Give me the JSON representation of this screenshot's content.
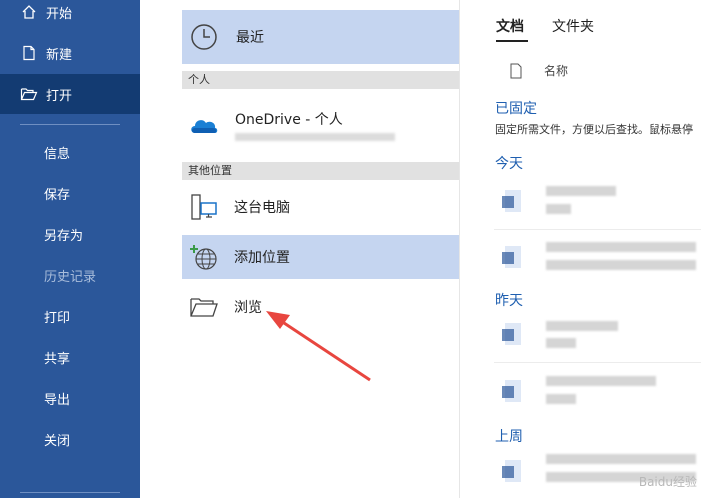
{
  "nav": {
    "home": "开始",
    "new": "新建",
    "open": "打开",
    "info": "信息",
    "save": "保存",
    "save_as": "另存为",
    "history": "历史记录",
    "print": "打印",
    "share": "共享",
    "export": "导出",
    "close": "关闭"
  },
  "locations": {
    "recent": "最近",
    "personal_header": "个人",
    "onedrive": "OneDrive - 个人",
    "other_header": "其他位置",
    "this_pc": "这台电脑",
    "add_place": "添加位置",
    "browse": "浏览"
  },
  "files": {
    "tab_documents": "文档",
    "tab_folders": "文件夹",
    "column_name": "名称",
    "pinned_title": "已固定",
    "pinned_desc": "固定所需文件，方便以后查找。鼠标悬停",
    "today": "今天",
    "yesterday": "昨天",
    "last_week": "上周"
  },
  "watermark": "Baidu经验",
  "colors": {
    "nav_bg": "#2b579a",
    "nav_active": "#133b72",
    "selected_location": "#c5d5f0",
    "group_title": "#1f5fb0",
    "annotation_arrow": "#e8463f"
  }
}
